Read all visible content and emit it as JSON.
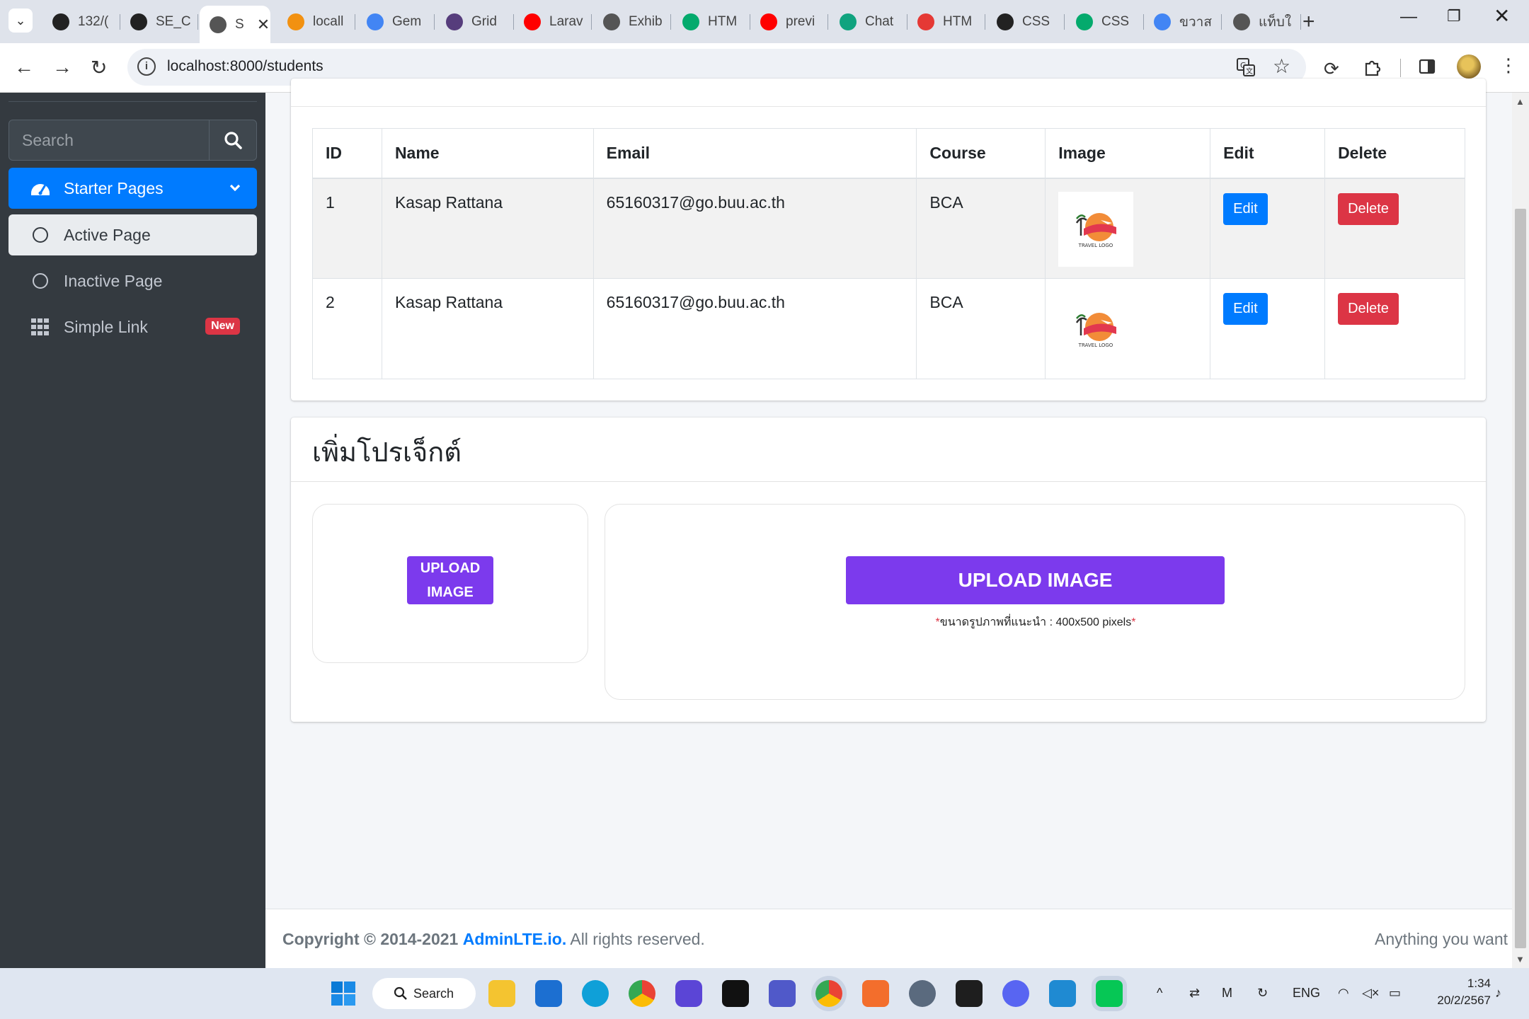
{
  "browser": {
    "tabs": [
      {
        "label": "132/(",
        "icon": "github-icon",
        "color": "#222"
      },
      {
        "label": "SE_C",
        "icon": "github-icon",
        "color": "#222"
      },
      {
        "label": "S",
        "icon": "globe-icon",
        "color": "#555",
        "active": true
      },
      {
        "label": "locall",
        "icon": "phpmyadmin-icon",
        "color": "#f29111"
      },
      {
        "label": "Gem",
        "icon": "gemini-icon",
        "color": "#4285f4"
      },
      {
        "label": "Grid",
        "icon": "bootstrap-icon",
        "color": "#563d7c"
      },
      {
        "label": "Larav",
        "icon": "youtube-icon",
        "color": "#ff0000"
      },
      {
        "label": "Exhib",
        "icon": "globe-icon",
        "color": "#555"
      },
      {
        "label": "HTM",
        "icon": "w3schools-icon",
        "color": "#04aa6d"
      },
      {
        "label": "previ",
        "icon": "youtube-icon",
        "color": "#ff0000"
      },
      {
        "label": "Chat",
        "icon": "chatgpt-icon",
        "color": "#10a37f"
      },
      {
        "label": "HTM",
        "icon": "devdocs-icon",
        "color": "#e53935"
      },
      {
        "label": "CSS",
        "icon": "css-icon",
        "color": "#222"
      },
      {
        "label": "CSS",
        "icon": "w3schools-icon",
        "color": "#04aa6d"
      },
      {
        "label": "ขวาส",
        "icon": "google-icon",
        "color": "#4285f4"
      },
      {
        "label": "แท็บใ",
        "icon": "chrome-icon",
        "color": "#555"
      }
    ],
    "url": "localhost:8000/students"
  },
  "sidebar": {
    "search_placeholder": "Search",
    "items": [
      {
        "label": "Starter Pages",
        "icon": "tachometer-icon"
      },
      {
        "label": "Active Page",
        "icon": "circle-icon"
      },
      {
        "label": "Inactive Page",
        "icon": "circle-icon"
      },
      {
        "label": "Simple Link",
        "icon": "grid-icon",
        "badge": "New"
      }
    ]
  },
  "table": {
    "headers": [
      "ID",
      "Name",
      "Email",
      "Course",
      "Image",
      "Edit",
      "Delete"
    ],
    "rows": [
      {
        "id": "1",
        "name": "Kasap Rattana",
        "email": "65160317@go.buu.ac.th",
        "course": "BCA",
        "image_text": "TRAVEL LOGO",
        "edit": "Edit",
        "delete": "Delete"
      },
      {
        "id": "2",
        "name": "Kasap Rattana",
        "email": "65160317@go.buu.ac.th",
        "course": "BCA",
        "image_text": "TRAVEL LOGO",
        "edit": "Edit",
        "delete": "Delete"
      }
    ]
  },
  "project": {
    "title": "เพิ่มโปรเจ็กต์",
    "upload_small_line1": "UPLOAD",
    "upload_small_line2": "IMAGE",
    "upload_big": "UPLOAD IMAGE",
    "hint_star": "*",
    "hint": "ขนาดรูปภาพที่แนะนำ : 400x500 pixels"
  },
  "footer": {
    "copyright": "Copyright © 2014-2021",
    "brand": "AdminLTE.io.",
    "rights": "All rights reserved.",
    "right_text": "Anything you want"
  },
  "taskbar": {
    "search": "Search",
    "lang": "ENG",
    "time": "1:34",
    "date": "20/2/2567"
  },
  "colors": {
    "primary": "#007bff",
    "danger": "#dc3545",
    "upload_purple": "#7c3aed",
    "sidebar_bg": "#343a40"
  }
}
